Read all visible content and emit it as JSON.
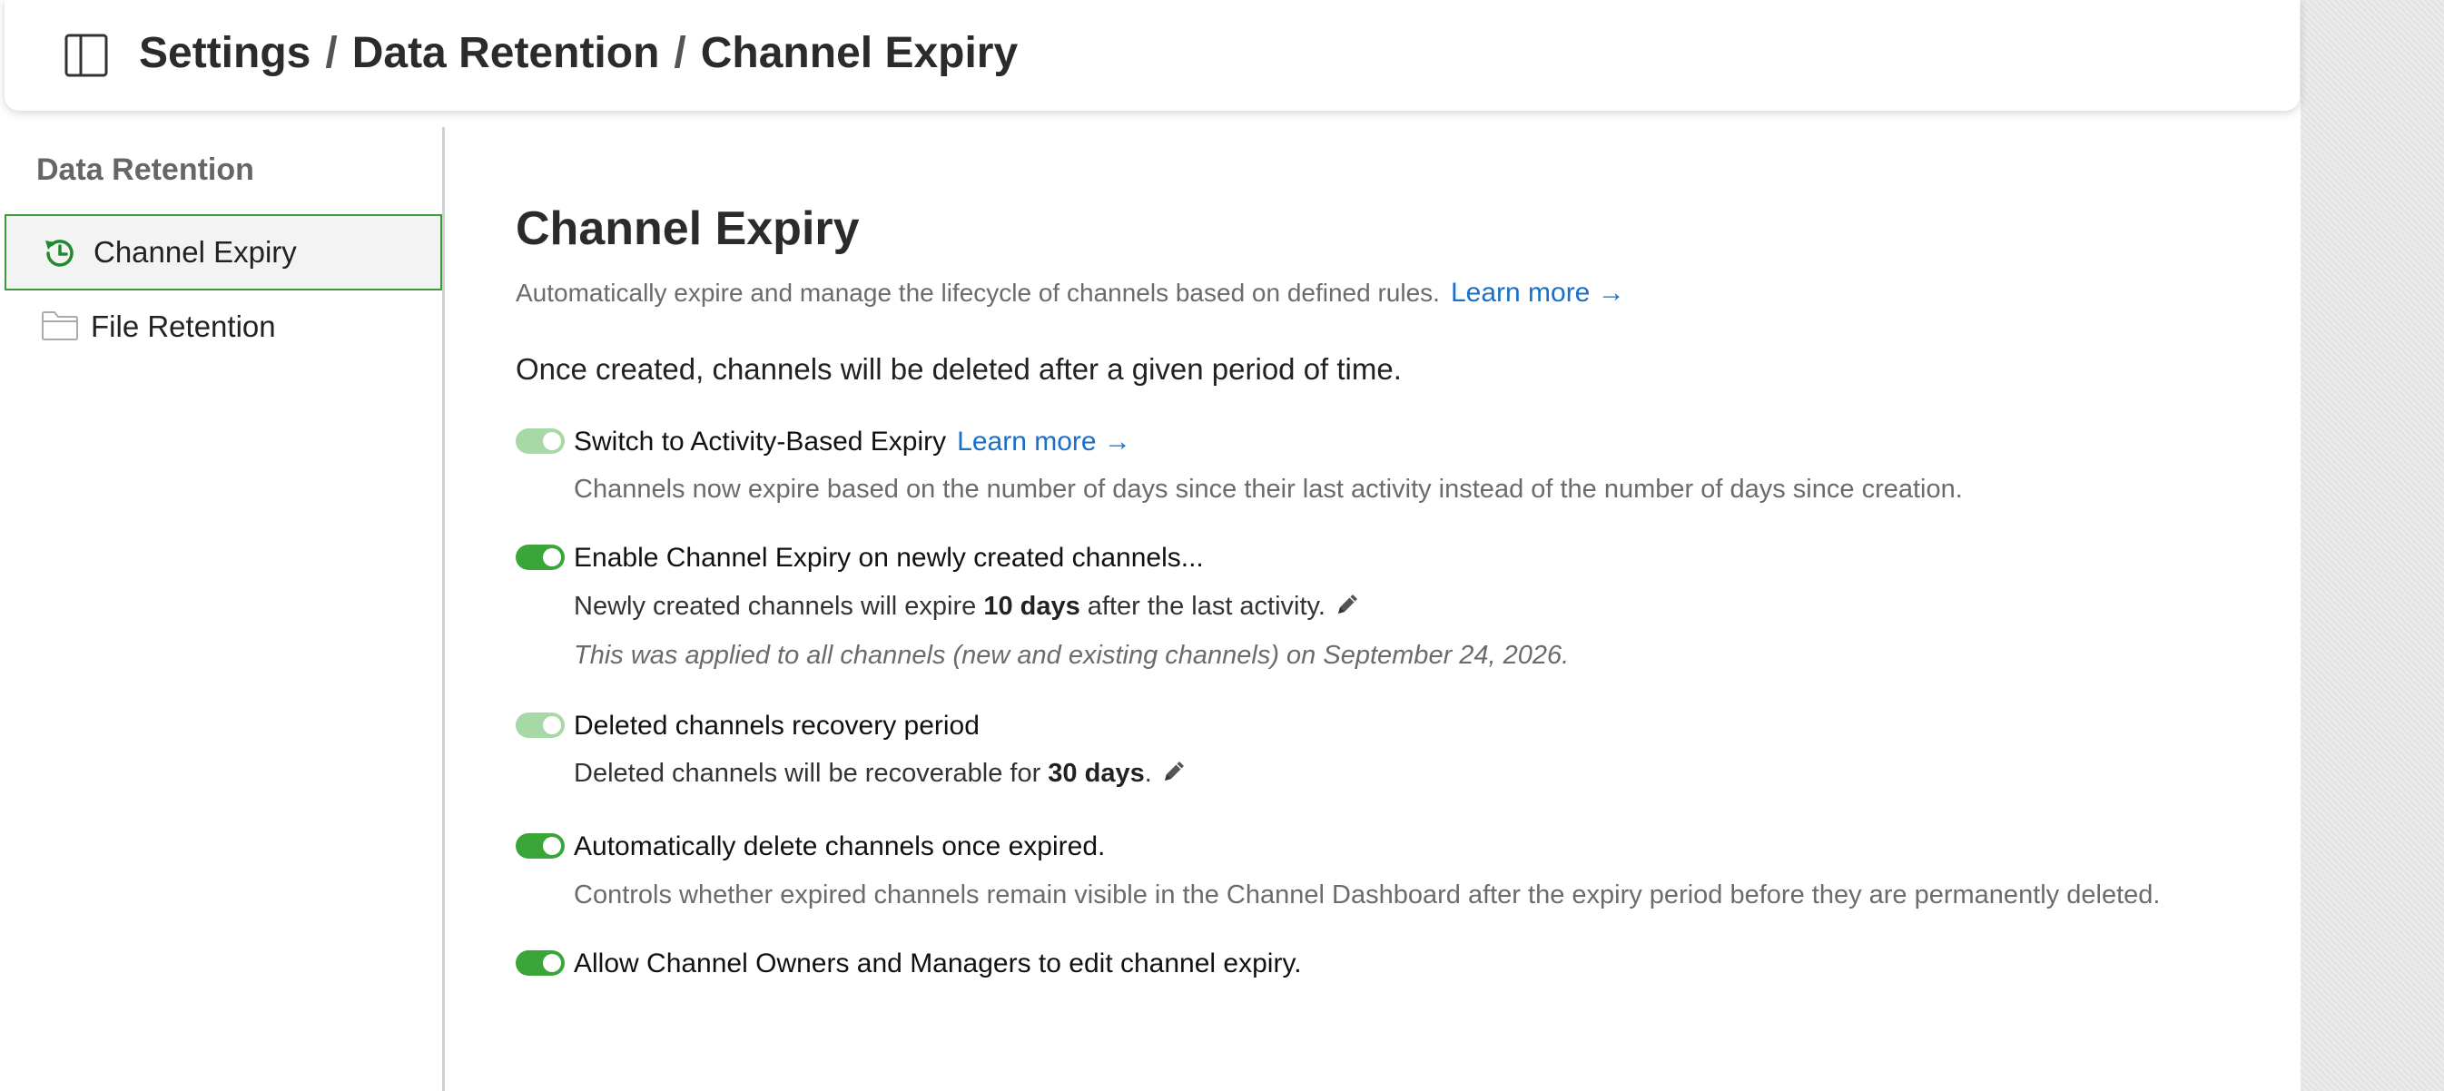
{
  "breadcrumb": {
    "items": [
      "Settings",
      "Data Retention",
      "Channel Expiry"
    ],
    "separator": "/"
  },
  "sidebar": {
    "title": "Data Retention",
    "items": [
      {
        "label": "Channel Expiry",
        "icon": "history-clock-icon",
        "active": true
      },
      {
        "label": "File Retention",
        "icon": "folder-icon",
        "active": false
      }
    ]
  },
  "main": {
    "title": "Channel Expiry",
    "subtitle": "Automatically expire and manage the lifecycle of channels based on defined rules.",
    "learn_more": "Learn more →",
    "intro": "Once created, channels will be deleted after a given period of time.",
    "settings": {
      "activity": {
        "label": "Switch to Activity-Based Expiry",
        "learn_more": "Learn more →",
        "description": "Channels now expire based on the number of days since their last activity instead of the number of days since creation.",
        "enabled": true
      },
      "enable_expiry": {
        "label": "Enable Channel Expiry on newly created channels...",
        "desc_prefix": "Newly created channels will expire ",
        "desc_value": "10 days",
        "desc_suffix": " after the last activity.",
        "note": "This was applied to all channels (new and existing channels) on September 24, 2026.",
        "enabled": true
      },
      "recovery": {
        "label": "Deleted channels recovery period",
        "desc_prefix": "Deleted channels will be recoverable for ",
        "desc_value": "30 days",
        "desc_suffix": ".",
        "enabled": true
      },
      "auto_delete": {
        "label": "Automatically delete channels once expired.",
        "description": "Controls whether expired channels remain visible in the Channel Dashboard after the expiry period before they are permanently deleted.",
        "enabled": true
      },
      "allow_owners": {
        "label": "Allow Channel Owners and Managers to edit channel expiry.",
        "enabled": true
      }
    }
  },
  "colors": {
    "accent_green": "#3aa63a",
    "accent_green_light": "#a6d9a6",
    "link_blue": "#1a6fc9"
  }
}
